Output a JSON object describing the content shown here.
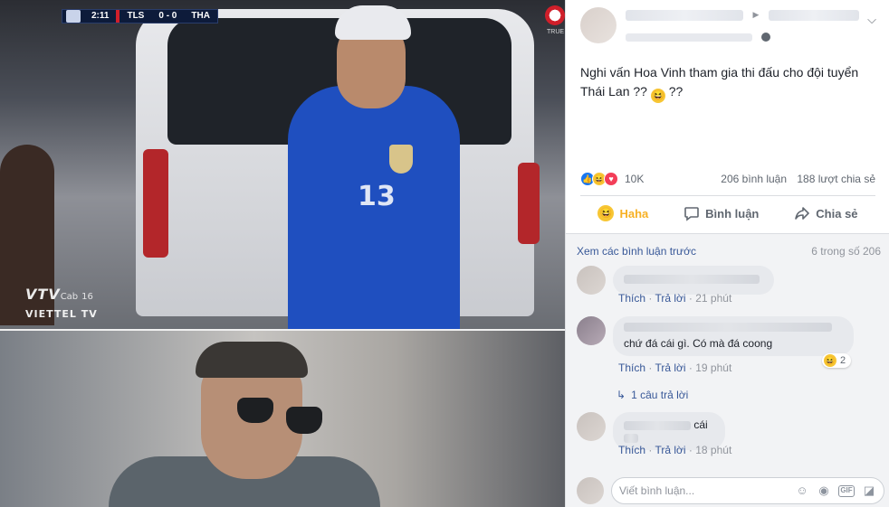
{
  "scoreboard": {
    "time": "2:11",
    "home": "TLS",
    "score": "0 - 0",
    "away": "THA"
  },
  "watermark": {
    "brand": "VTV",
    "sub": "Cab",
    "channel": "16",
    "network": "VIETTEL TV"
  },
  "corner_logo_text": "TRUE",
  "jersey_number": "13",
  "post": {
    "text_line1": "Nghi vấn Hoa Vinh tham gia thi đấu cho đội tuyển",
    "text_line2_prefix": "Thái Lan ?? ",
    "text_line2_suffix": " ??",
    "reactions_count": "10K",
    "comments_count": "206 bình luận",
    "shares_count": "188 lượt chia sẻ"
  },
  "actions": {
    "haha": "Haha",
    "comment": "Bình luận",
    "share": "Chia sẻ"
  },
  "comments_section": {
    "prev_link": "Xem các bình luận trước",
    "count": "6 trong số 206",
    "comments": [
      {
        "text": "",
        "like": "Thích",
        "reply": "Trả lời",
        "time": "21 phút"
      },
      {
        "text": "chứ đá cái gì. Có mà đá coong",
        "like": "Thích",
        "reply": "Trả lời",
        "time": "19 phút",
        "reaction_count": "2",
        "replies_link": "1 câu trả lời"
      },
      {
        "text": "cái",
        "like": "Thích",
        "reply": "Trả lời",
        "time": "18 phút"
      }
    ],
    "compose_placeholder": "Viết bình luận..."
  },
  "icons": [
    "menu-chevron-icon",
    "globe-icon",
    "like-icon",
    "haha-icon",
    "love-icon",
    "comment-icon",
    "share-icon",
    "reply-arrow-icon",
    "smiley-icon",
    "camera-icon",
    "gif-icon",
    "sticker-icon"
  ],
  "colors": {
    "link": "#385898",
    "haha_active": "#f7b125",
    "like_blue": "#1877f2",
    "love_red": "#f33e58"
  }
}
